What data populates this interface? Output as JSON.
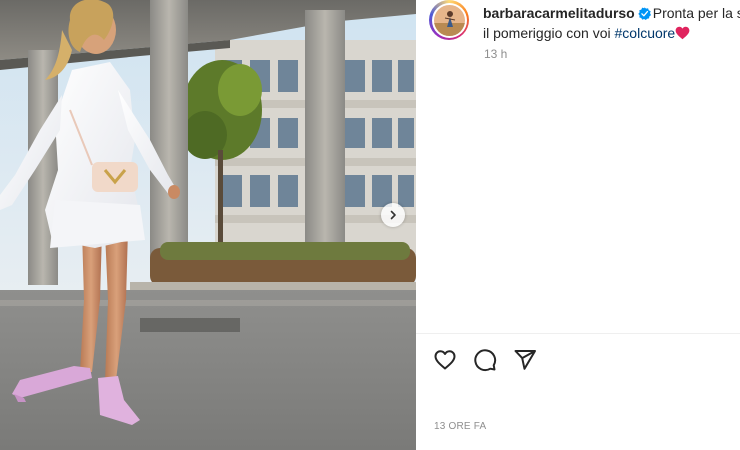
{
  "post": {
    "username": "barbaracarmelitadurso",
    "caption_line1": "Pronta per la se",
    "caption_line2_text": "il pomeriggio con voi ",
    "hashtag": "#colcuore",
    "relative_time": "13 h",
    "date_label": "13 ORE FA",
    "verified": true
  },
  "icons": {
    "verified": "verified-badge-icon",
    "caption_emoji": "red-heart-emoji-icon",
    "like": "heart-icon",
    "comment": "comment-bubble-icon",
    "share": "paper-plane-icon",
    "carousel_next": "chevron-right-icon"
  },
  "colors": {
    "verified_blue": "#0095f6",
    "hashtag_link": "#00376b",
    "emoji_red": "#e0245e",
    "secondary_text": "#8e8e8e"
  }
}
